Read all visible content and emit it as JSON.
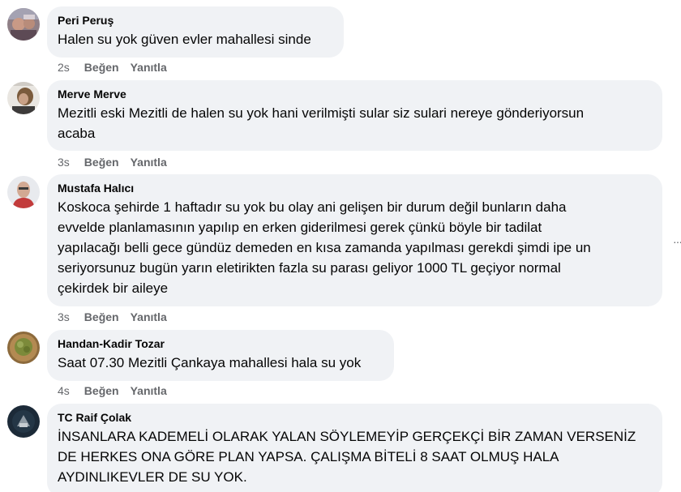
{
  "comments": [
    {
      "author": "Peri Peruş",
      "text": "Halen su yok güven evler mahallesi sinde",
      "time": "2s",
      "like": "Beğen",
      "reply": "Yanıtla"
    },
    {
      "author": "Merve Merve",
      "text": "Mezitli eski Mezitli de halen su yok hani verilmişti sular siz sulari nereye gönderiyorsun\nacaba",
      "time": "3s",
      "like": "Beğen",
      "reply": "Yanıtla"
    },
    {
      "author": "Mustafa Halıcı",
      "text": "Koskoca şehirde 1 haftadır su yok bu olay ani gelişen bir durum değil bunların daha\nevvelde planlamasının yapılıp en erken giderilmesi gerek çünkü böyle bir tadilat\nyapılacağı belli gece gündüz demeden en kısa zamanda yapılması gerekdi şimdi ipe un\nseriyorsunuz bugün yarın eletirikten fazla su parası geliyor 1000 TL geçiyor normal\nçekirdek bir aileye",
      "time": "3s",
      "like": "Beğen",
      "reply": "Yanıtla"
    },
    {
      "author": "Handan-Kadir Tozar",
      "text": "Saat 07.30 Mezitli Çankaya mahallesi hala su yok",
      "time": "4s",
      "like": "Beğen",
      "reply": "Yanıtla"
    },
    {
      "author": "TC Raif Çolak",
      "text": "İNSANLARA KADEMELİ OLARAK YALAN SÖYLEMEYİP GERÇEKÇİ BİR ZAMAN VERSENİZ\nDE HERKES ONA GÖRE PLAN YAPSA. ÇALIŞMA BİTELİ 8 SAAT OLMUŞ HALA\nAYDINLIKEVLER DE SU YOK."
    }
  ],
  "more_icon": "more-options-icon"
}
